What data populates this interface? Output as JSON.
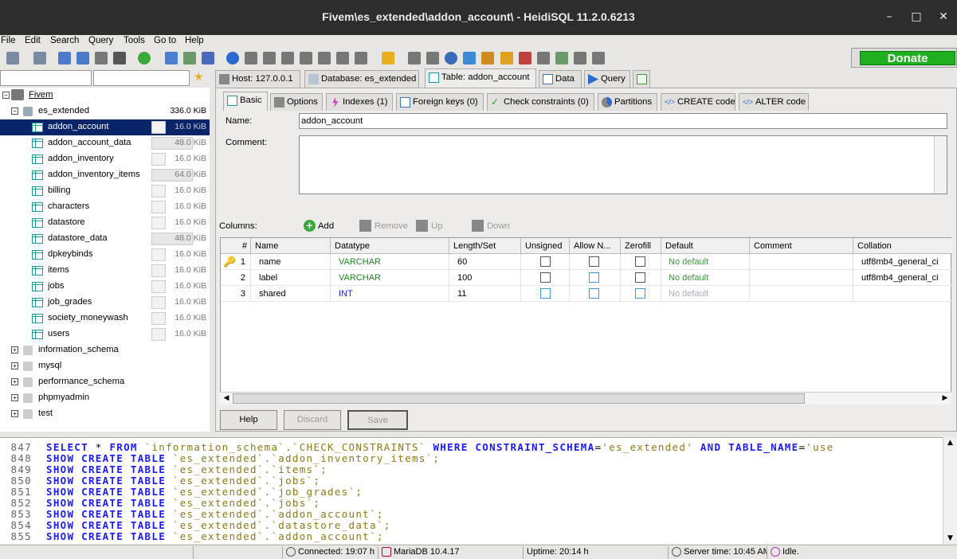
{
  "window": {
    "title": "Fivem\\es_extended\\addon_account\\ - HeidiSQL 11.2.0.6213"
  },
  "menu": [
    "File",
    "Edit",
    "Search",
    "Query",
    "Tools",
    "Go to",
    "Help"
  ],
  "donate_label": "Donate",
  "tree": {
    "root": "Fivem",
    "db": {
      "name": "es_extended",
      "size": "336.0 KiB"
    },
    "tables": [
      {
        "name": "addon_account",
        "size": "16.0 KiB",
        "fill": 0
      },
      {
        "name": "addon_account_data",
        "size": "48.0 KiB",
        "fill": 1
      },
      {
        "name": "addon_inventory",
        "size": "16.0 KiB",
        "fill": 0
      },
      {
        "name": "addon_inventory_items",
        "size": "64.0 KiB",
        "fill": 1
      },
      {
        "name": "billing",
        "size": "16.0 KiB",
        "fill": 0
      },
      {
        "name": "characters",
        "size": "16.0 KiB",
        "fill": 0
      },
      {
        "name": "datastore",
        "size": "16.0 KiB",
        "fill": 0
      },
      {
        "name": "datastore_data",
        "size": "48.0 KiB",
        "fill": 1
      },
      {
        "name": "dpkeybinds",
        "size": "16.0 KiB",
        "fill": 0
      },
      {
        "name": "items",
        "size": "16.0 KiB",
        "fill": 0
      },
      {
        "name": "jobs",
        "size": "16.0 KiB",
        "fill": 0
      },
      {
        "name": "job_grades",
        "size": "16.0 KiB",
        "fill": 0
      },
      {
        "name": "society_moneywash",
        "size": "16.0 KiB",
        "fill": 0
      },
      {
        "name": "users",
        "size": "16.0 KiB",
        "fill": 0
      }
    ],
    "other_dbs": [
      "information_schema",
      "mysql",
      "performance_schema",
      "phpmyadmin",
      "test"
    ]
  },
  "main_tabs": {
    "host": "Host: 127.0.0.1",
    "database": "Database: es_extended",
    "table": "Table: addon_account",
    "data": "Data",
    "query": "Query"
  },
  "sub_tabs": {
    "basic": "Basic",
    "options": "Options",
    "indexes": "Indexes (1)",
    "foreign_keys": "Foreign keys (0)",
    "check_constraints": "Check constraints (0)",
    "partitions": "Partitions",
    "create_code": "CREATE code",
    "alter_code": "ALTER code"
  },
  "form": {
    "name_label": "Name:",
    "name_value": "addon_account",
    "comment_label": "Comment:",
    "columns_label": "Columns:",
    "add": "Add",
    "remove": "Remove",
    "up": "Up",
    "down": "Down"
  },
  "columns_grid": {
    "headers": [
      "#",
      "Name",
      "Datatype",
      "Length/Set",
      "Unsigned",
      "Allow N...",
      "Zerofill",
      "Default",
      "Comment",
      "Collation"
    ],
    "rows": [
      {
        "num": "1",
        "name": "name",
        "datatype": "VARCHAR",
        "length": "60",
        "default": "No default",
        "collation": "utf8mb4_general_ci"
      },
      {
        "num": "2",
        "name": "label",
        "datatype": "VARCHAR",
        "length": "100",
        "default": "No default",
        "collation": "utf8mb4_general_ci"
      },
      {
        "num": "3",
        "name": "shared",
        "datatype": "INT",
        "length": "11",
        "default": "No default",
        "collation": ""
      }
    ]
  },
  "buttons": {
    "help": "Help",
    "discard": "Discard",
    "save": "Save"
  },
  "log": [
    {
      "n": "847",
      "parts": [
        [
          "k",
          "SELECT"
        ],
        [
          "p",
          " * "
        ],
        [
          "k",
          "FROM"
        ],
        [
          "p",
          " "
        ],
        [
          "s",
          "`information_schema`.`CHECK_CONSTRAINTS`"
        ],
        [
          "p",
          " "
        ],
        [
          "k",
          "WHERE"
        ],
        [
          "p",
          " "
        ],
        [
          "k",
          "CONSTRAINT_SCHEMA"
        ],
        [
          "p",
          "="
        ],
        [
          "s",
          "'es_extended'"
        ],
        [
          "p",
          " "
        ],
        [
          "k",
          "AND"
        ],
        [
          "p",
          " "
        ],
        [
          "k",
          "TABLE_NAME"
        ],
        [
          "p",
          "="
        ],
        [
          "s",
          "'use"
        ]
      ]
    },
    {
      "n": "848",
      "parts": [
        [
          "k",
          "SHOW CREATE TABLE"
        ],
        [
          "p",
          " "
        ],
        [
          "s",
          "`es_extended`.`addon_inventory_items`;"
        ]
      ]
    },
    {
      "n": "849",
      "parts": [
        [
          "k",
          "SHOW CREATE TABLE"
        ],
        [
          "p",
          " "
        ],
        [
          "s",
          "`es_extended`.`items`;"
        ]
      ]
    },
    {
      "n": "850",
      "parts": [
        [
          "k",
          "SHOW CREATE TABLE"
        ],
        [
          "p",
          " "
        ],
        [
          "s",
          "`es_extended`.`jobs`;"
        ]
      ]
    },
    {
      "n": "851",
      "parts": [
        [
          "k",
          "SHOW CREATE TABLE"
        ],
        [
          "p",
          " "
        ],
        [
          "s",
          "`es_extended`.`job_grades`;"
        ]
      ]
    },
    {
      "n": "852",
      "parts": [
        [
          "k",
          "SHOW CREATE TABLE"
        ],
        [
          "p",
          " "
        ],
        [
          "s",
          "`es_extended`.`jobs`;"
        ]
      ]
    },
    {
      "n": "853",
      "parts": [
        [
          "k",
          "SHOW CREATE TABLE"
        ],
        [
          "p",
          " "
        ],
        [
          "s",
          "`es_extended`.`addon_account`;"
        ]
      ]
    },
    {
      "n": "854",
      "parts": [
        [
          "k",
          "SHOW CREATE TABLE"
        ],
        [
          "p",
          " "
        ],
        [
          "s",
          "`es_extended`.`datastore_data`;"
        ]
      ]
    },
    {
      "n": "855",
      "parts": [
        [
          "k",
          "SHOW CREATE TABLE"
        ],
        [
          "p",
          " "
        ],
        [
          "s",
          "`es_extended`.`addon_account`;"
        ]
      ]
    }
  ],
  "status": {
    "connected": "Connected: 19:07 h",
    "server": "MariaDB 10.4.17",
    "uptime": "Uptime: 20:14 h",
    "server_time": "Server time: 10:45 AM",
    "state": "Idle."
  },
  "colors": {
    "accent": "#0a246a",
    "keyword": "#1a1aff",
    "string": "#8a7a14",
    "donate": "#1fb01f"
  }
}
